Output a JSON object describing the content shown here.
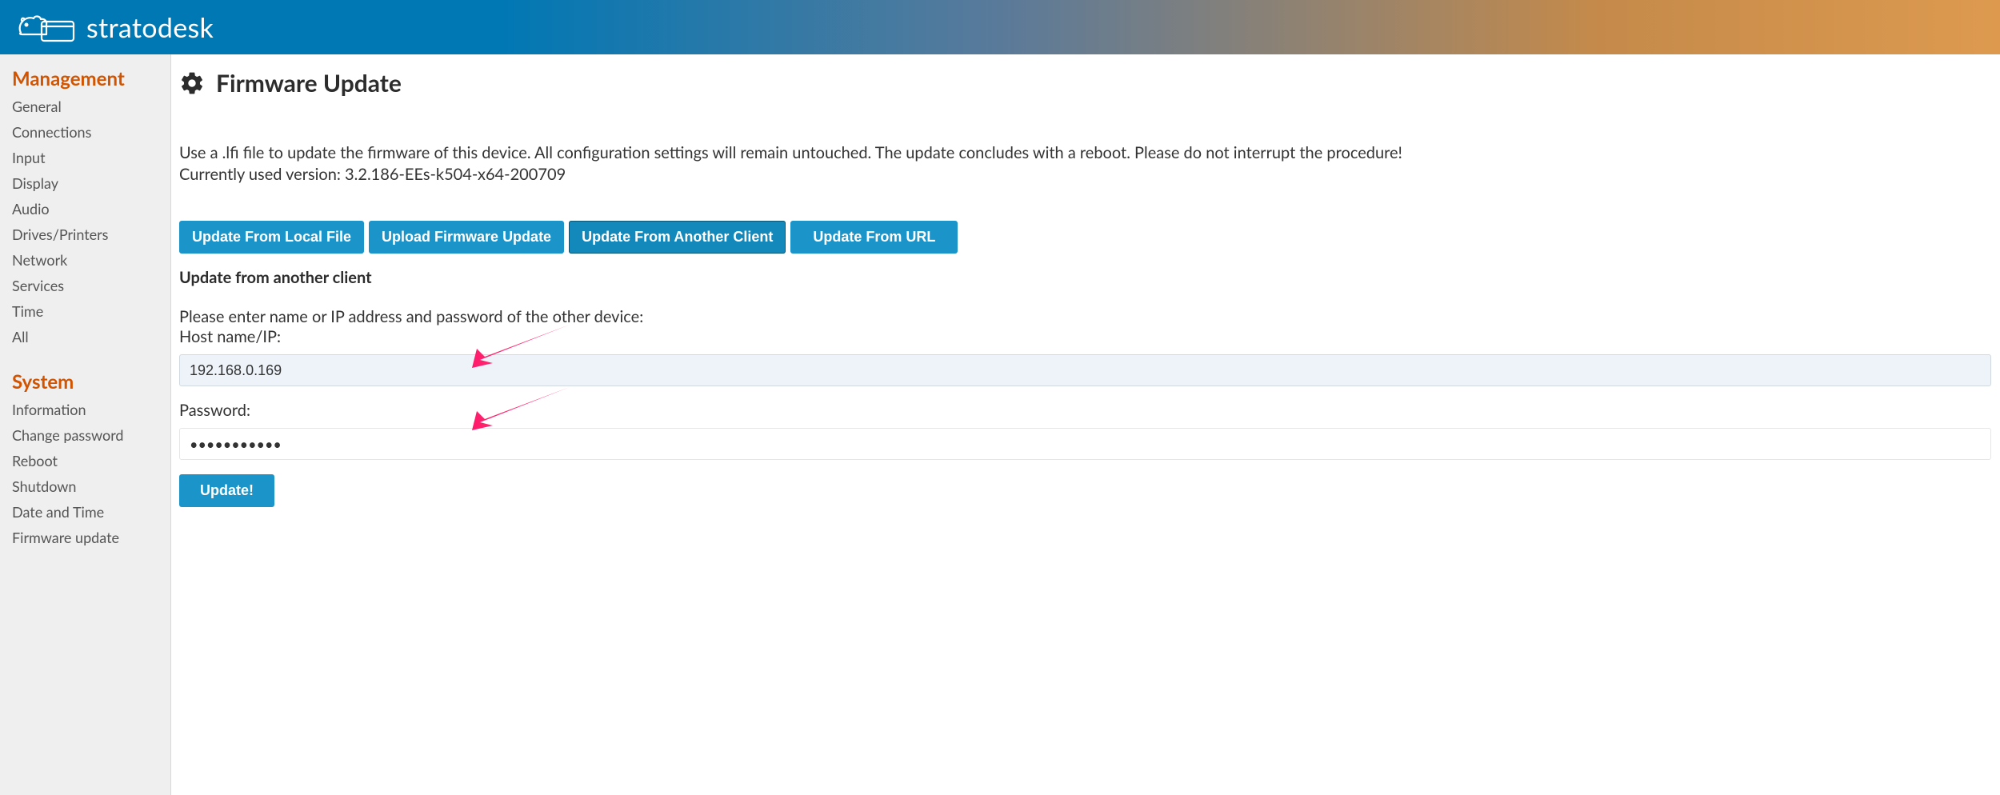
{
  "brand": "stratodesk",
  "sidebar": {
    "management": {
      "title": "Management",
      "items": [
        "General",
        "Connections",
        "Input",
        "Display",
        "Audio",
        "Drives/Printers",
        "Network",
        "Services",
        "Time",
        "All"
      ]
    },
    "system": {
      "title": "System",
      "items": [
        "Information",
        "Change password",
        "Reboot",
        "Shutdown",
        "Date and Time",
        "Firmware update"
      ]
    }
  },
  "page": {
    "title": "Firmware Update",
    "desc_line1": "Use a .lfi file to update the firmware of this device. All configuration settings will remain untouched. The update concludes with a reboot. Please do not interrupt the procedure!",
    "desc_line2": "Currently used version: 3.2.186-EEs-k504-x64-200709"
  },
  "tabs": {
    "local": "Update From Local File",
    "upload": "Upload Firmware Update",
    "another": "Update From Another Client",
    "url": "Update From URL"
  },
  "form": {
    "heading": "Update from another client",
    "instruction": "Please enter name or IP address and password of the other device:",
    "host_label": "Host name/IP:",
    "host_value": "192.168.0.169",
    "password_label": "Password:",
    "password_value": "•••••••••••",
    "submit": "Update!"
  }
}
